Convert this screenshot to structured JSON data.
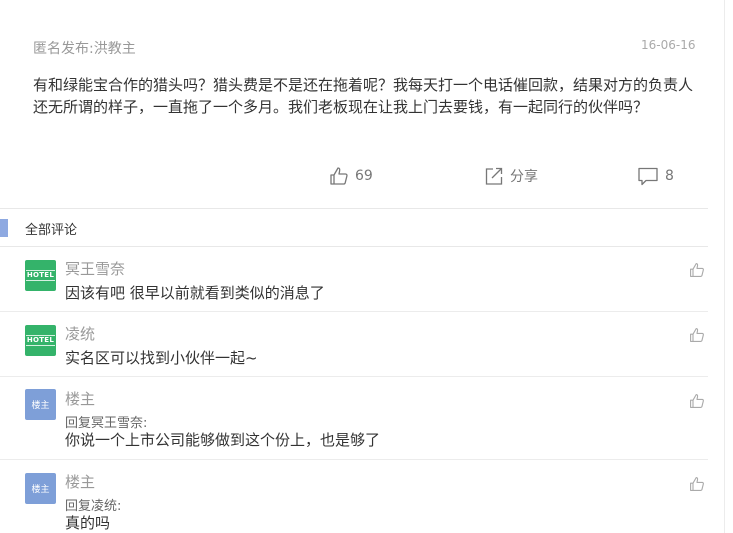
{
  "post": {
    "author": "匿名发布:洪教主",
    "date": "16-06-16",
    "body": "有和绿能宝合作的猎头吗？猎头费是不是还在拖着呢？我每天打一个电话催回款，结果对方的负责人还无所谓的样子，一直拖了一个多月。我们老板现在让我上门去要钱，有一起同行的伙伴吗？"
  },
  "actions": {
    "like_count": "69",
    "share_label": "分享",
    "comment_count": "8"
  },
  "comments_section": {
    "title": "全部评论"
  },
  "comments": [
    {
      "name": "冥王雪奈",
      "avatar_text": "HOTEL",
      "reply_to": "",
      "text": "因该有吧 很早以前就看到类似的消息了"
    },
    {
      "name": "凌统",
      "avatar_text": "HOTEL",
      "reply_to": "",
      "text": "实名区可以找到小伙伴一起~"
    },
    {
      "name": "楼主",
      "avatar_text": "楼主",
      "reply_to": "回复冥王雪奈:",
      "text": "你说一个上市公司能够做到这个份上，也是够了"
    },
    {
      "name": "楼主",
      "avatar_text": "楼主",
      "reply_to": "回复凌统:",
      "text": "真的吗"
    }
  ],
  "colors": {
    "owner_avatar": "#7e9fd8",
    "hotel_avatar": "#34b36a",
    "section_accent": "#8ea9e1"
  },
  "icons": [
    "thumbs-up-icon",
    "share-icon",
    "comment-icon"
  ]
}
